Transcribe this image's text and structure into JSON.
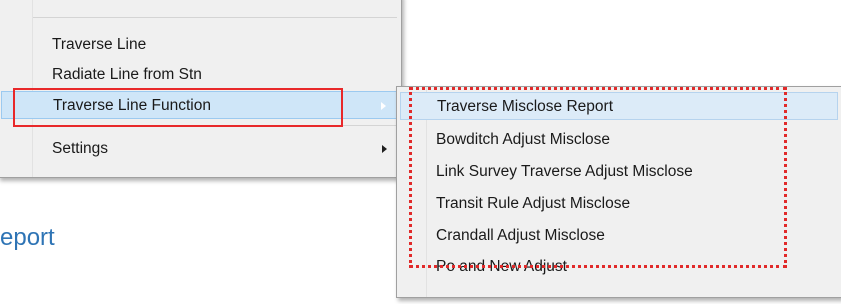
{
  "main_menu": {
    "items": [
      {
        "label": "Traverse Line"
      },
      {
        "label": "Radiate Line from Stn"
      },
      {
        "label": "Traverse Line Function"
      },
      {
        "label": "Settings"
      }
    ]
  },
  "submenu": {
    "items": [
      {
        "label": "Traverse Misclose Report"
      },
      {
        "label": "Bowditch Adjust Misclose"
      },
      {
        "label": "Link Survey Traverse Adjust Misclose"
      },
      {
        "label": "Transit Rule Adjust Misclose"
      },
      {
        "label": "Crandall Adjust Misclose"
      },
      {
        "label": "Po and New Adjust"
      }
    ]
  },
  "page": {
    "caption": "eport"
  },
  "colors": {
    "highlight_box": "#e8282a",
    "caption": "#2e74b5",
    "menu_highlight": "#cfe6f8"
  }
}
